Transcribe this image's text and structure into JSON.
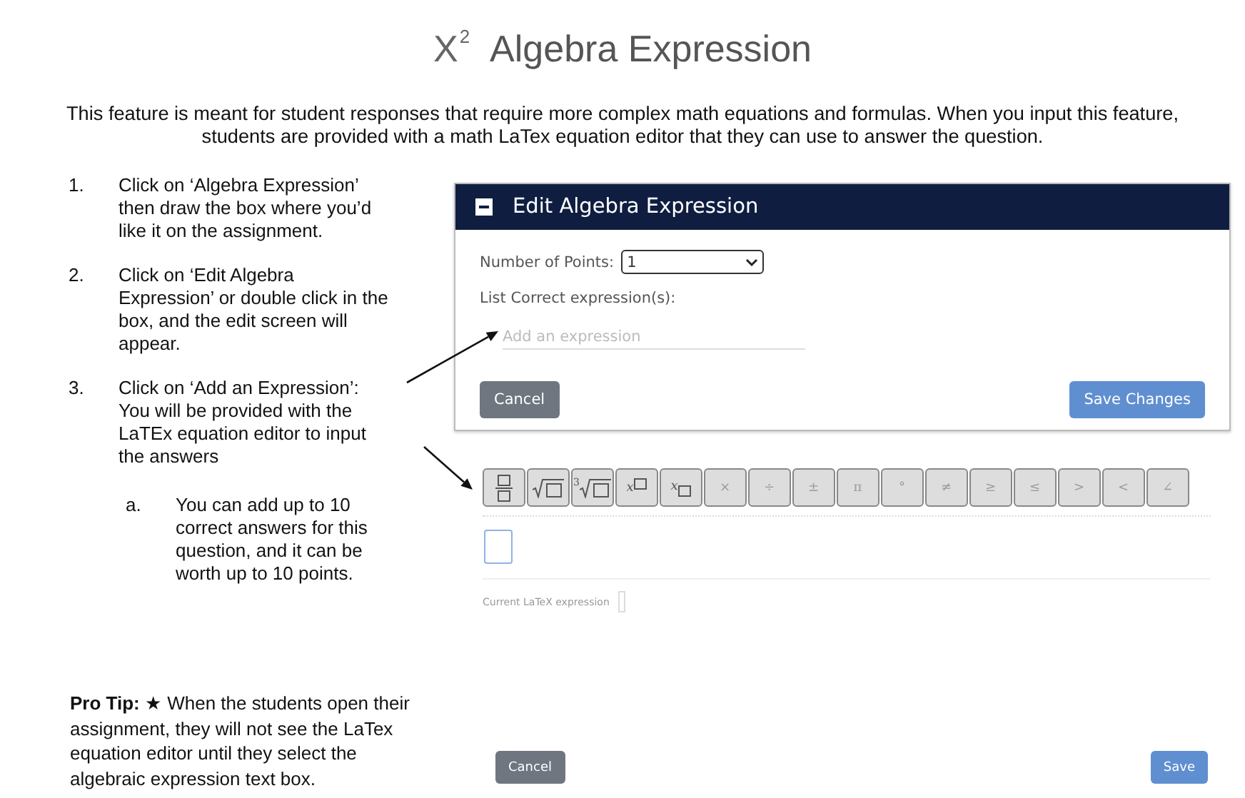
{
  "title": {
    "base": "X",
    "exponent": "2",
    "text": "Algebra Expression"
  },
  "intro": "This feature is meant for student responses that require more complex math equations and formulas. When you input this feature, students are provided with a math LaTex equation editor that they can use to answer the question.",
  "steps": [
    {
      "marker": "1.",
      "text": "Click on ‘Algebra Expression’ then draw the box where you’d like it on the assignment."
    },
    {
      "marker": "2.",
      "text": "Click on ‘Edit Algebra Expression’ or double click in the box, and the edit screen will appear."
    },
    {
      "marker": "3.",
      "text": "Click on ‘Add an Expression’: You will be provided with the LaTEx equation editor to input the answers",
      "children": [
        {
          "marker": "a.",
          "text": "You can add up to 10 correct answers for this question, and it can be worth up to 10 points."
        }
      ]
    }
  ],
  "pro_tip": "**Pro Tip:** ★ When the students open their assignment, they will not see the LaTex equation editor until they select the algebraic expression text box.",
  "dialog": {
    "title": "Edit Algebra Expression",
    "points_label": "Number of Points:",
    "points_value": "1",
    "list_label": "List Correct expression(s):",
    "expression_placeholder": "Add an expression",
    "buttons": [
      {
        "label": "Cancel",
        "kind": "secondary"
      },
      {
        "label": "Save Changes",
        "kind": "primary"
      }
    ]
  },
  "editor": {
    "toolbar": [
      {
        "kind": "fraction"
      },
      {
        "kind": "root"
      },
      {
        "kind": "root",
        "index": "3"
      },
      {
        "kind": "superscript",
        "base": "x"
      },
      {
        "kind": "subscript",
        "base": "x"
      },
      {
        "kind": "symbol",
        "label": "×"
      },
      {
        "kind": "symbol",
        "label": "÷"
      },
      {
        "kind": "symbol",
        "label": "±"
      },
      {
        "kind": "symbol",
        "label": "π"
      },
      {
        "kind": "symbol",
        "label": "°"
      },
      {
        "kind": "symbol",
        "label": "≠"
      },
      {
        "kind": "symbol",
        "label": "≥"
      },
      {
        "kind": "symbol",
        "label": "≤"
      },
      {
        "kind": "symbol",
        "label": ">"
      },
      {
        "kind": "symbol",
        "label": "<"
      },
      {
        "kind": "symbol",
        "label": "∠"
      }
    ],
    "latex_label": "Current LaTeX expression",
    "buttons": [
      {
        "label": "Cancel",
        "kind": "secondary"
      },
      {
        "label": "Save",
        "kind": "primary"
      }
    ]
  }
}
